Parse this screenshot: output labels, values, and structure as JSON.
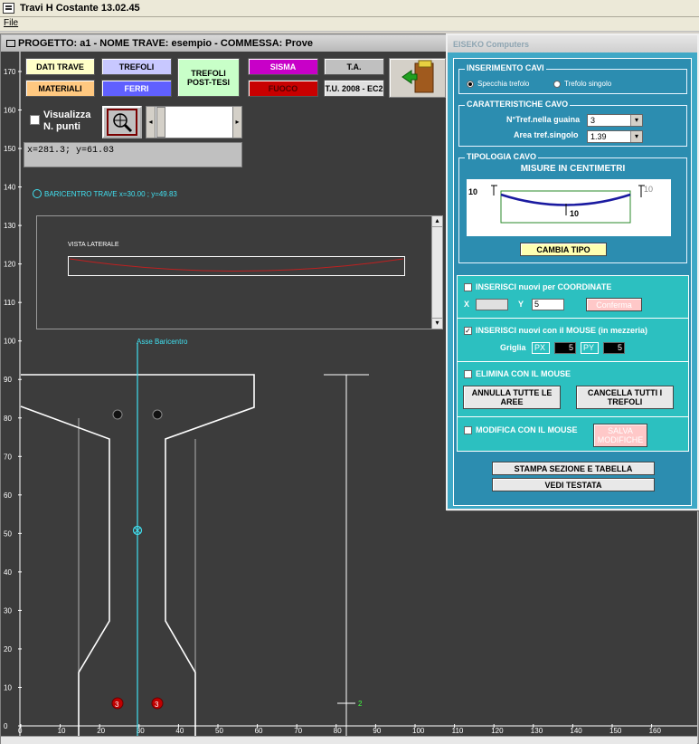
{
  "app": {
    "title": "Travi H Costante  13.02.45",
    "menu": {
      "file": "File"
    }
  },
  "inner": {
    "title": "PROGETTO: a1 - NOME TRAVE: esempio - COMMESSA: Prove"
  },
  "toolbar": {
    "dati_trave": "DATI TRAVE",
    "trefoli": "TREFOLI",
    "trefoli_post": "TREFOLI\nPOST-TESI",
    "sisma": "SISMA",
    "ta": "T.A.",
    "materiali": "MATERIALI",
    "ferri": "FERRI",
    "fuoco": "FUOCO",
    "tu": "T.U. 2008 - EC2"
  },
  "colors": {
    "dati_trave": "#ffffc8",
    "materiali": "#ffc880",
    "trefoli": "#c8c8ff",
    "ferri": "#6060ff",
    "trefoli_post": "#c8ffc8",
    "sisma": "#c800c8",
    "fuoco": "#c80000",
    "ta": "#c0c0c0"
  },
  "options": {
    "visualizza": "Visualizza\nN. punti"
  },
  "coord": {
    "readout": "x=281.3; y=61.03"
  },
  "baricentro": {
    "label": "BARICENTRO TRAVE  x=30.00 ; y=49.83"
  },
  "vista": {
    "label": "VISTA LATERALE"
  },
  "asse": {
    "label": "Asse Baricentro"
  },
  "y_axis": [
    "170",
    "160",
    "150",
    "140",
    "130",
    "120",
    "110",
    "100",
    "90",
    "80",
    "70",
    "60",
    "50",
    "40",
    "30",
    "20",
    "10",
    "0"
  ],
  "x_axis": [
    "0",
    "10",
    "20",
    "30",
    "40",
    "50",
    "60",
    "70",
    "80",
    "90",
    "100",
    "110",
    "120",
    "130",
    "140",
    "150",
    "160"
  ],
  "strands": {
    "bottom_count_left": "3",
    "bottom_count_right": "3",
    "line_count": "2"
  },
  "panel": {
    "title": "EISEKO Computers",
    "inserimento": {
      "title": "INSERIMENTO CAVI",
      "opt1": "Specchia trefolo",
      "opt2": "Trefolo singolo"
    },
    "caratteristiche": {
      "title": "CARATTERISTICHE CAVO",
      "ntref_label": "N°Tref.nella guaina",
      "ntref_value": "3",
      "area_label": "Area tref.singolo",
      "area_value": "1.39"
    },
    "tipologia": {
      "title": "TIPOLOGIA CAVO",
      "misure": "MISURE IN CENTIMETRI",
      "d_left": "10",
      "d_right": "10",
      "d_bottom": "10",
      "cambia": "CAMBIA TIPO"
    },
    "coordinate": {
      "label": "INSERISCI nuovi per COORDINATE",
      "x_label": "X",
      "y_label": "Y",
      "y_value": "5",
      "conferma": "Conferma"
    },
    "mouse": {
      "label": "INSERISCI nuovi con il MOUSE (in mezzeria)",
      "griglia": "Griglia",
      "px": "PX",
      "px_value": "5",
      "py": "PY",
      "py_value": "5"
    },
    "elimina": {
      "label": "ELIMINA CON IL MOUSE",
      "annulla": "ANNULLA TUTTE LE AREE",
      "cancella": "CANCELLA TUTTI I TREFOLI"
    },
    "modifica": {
      "label": "MODIFICA CON IL MOUSE",
      "salva": "SALVA MODIFICHE"
    },
    "stampa": "STAMPA SEZIONE E TABELLA",
    "vedi": "VEDI TESTATA"
  }
}
